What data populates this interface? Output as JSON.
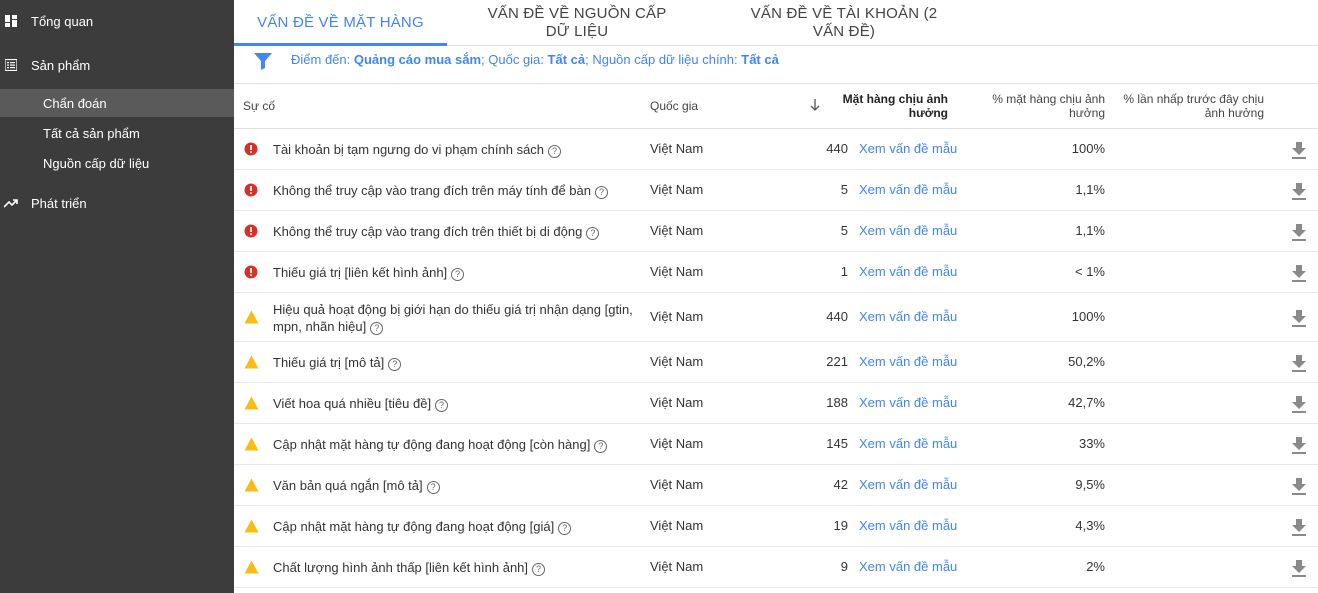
{
  "sidebar": {
    "items": [
      {
        "label": "Tổng quan",
        "icon": "dashboard-icon"
      },
      {
        "label": "Sản phẩm",
        "icon": "list-icon"
      },
      {
        "label": "Phát triển",
        "icon": "trending-icon"
      }
    ],
    "sub_items": [
      {
        "label": "Chẩn đoán",
        "active": true
      },
      {
        "label": "Tất cả sản phẩm",
        "active": false
      },
      {
        "label": "Nguồn cấp dữ liệu",
        "active": false
      }
    ]
  },
  "tabs": [
    {
      "label": "VẤN ĐỀ VỀ MẶT HÀNG",
      "active": true
    },
    {
      "label": "VẤN ĐỀ VỀ NGUỒN CẤP DỮ LIỆU",
      "active": false
    },
    {
      "label": "VẤN ĐỀ VỀ TÀI KHOẢN (2 VẤN ĐỀ)",
      "active": false
    }
  ],
  "filter": {
    "destination_label": "Điểm đến:",
    "destination_value": "Quảng cáo mua sắm",
    "country_label": "; Quốc gia:",
    "country_value": "Tất cả",
    "feed_label": "; Nguồn cấp dữ liệu chính:",
    "feed_value": "Tất cả"
  },
  "table": {
    "headers": {
      "issue": "Sự cố",
      "country": "Quốc gia",
      "affected": "Mặt hàng chịu ảnh hưởng",
      "pct_affected": "% mặt hàng chịu ảnh hưởng",
      "pct_clicks": "% lần nhấp trước đây chịu ảnh hưởng"
    },
    "sort_icon": "arrow-down-icon",
    "rows": [
      {
        "severity": "error",
        "issue": "Tài khoản bị tạm ngưng do vi phạm chính sách",
        "country": "Việt Nam",
        "count": "440",
        "link": "Xem vấn đề mẫu",
        "pct": "100%"
      },
      {
        "severity": "error",
        "issue": "Không thể truy cập vào trang đích trên máy tính để bàn",
        "country": "Việt Nam",
        "count": "5",
        "link": "Xem vấn đề mẫu",
        "pct": "1,1%"
      },
      {
        "severity": "error",
        "issue": "Không thể truy cập vào trang đích trên thiết bị di động",
        "country": "Việt Nam",
        "count": "5",
        "link": "Xem vấn đề mẫu",
        "pct": "1,1%"
      },
      {
        "severity": "error",
        "issue": "Thiếu giá trị [liên kết hình ảnh]",
        "country": "Việt Nam",
        "count": "1",
        "link": "Xem vấn đề mẫu",
        "pct": "< 1%"
      },
      {
        "severity": "warning",
        "issue": "Hiệu quả hoạt động bị giới hạn do thiếu giá trị nhận dạng [gtin, mpn, nhãn hiệu]",
        "country": "Việt Nam",
        "count": "440",
        "link": "Xem vấn đề mẫu",
        "pct": "100%"
      },
      {
        "severity": "warning",
        "issue": "Thiếu giá trị [mô tả]",
        "country": "Việt Nam",
        "count": "221",
        "link": "Xem vấn đề mẫu",
        "pct": "50,2%"
      },
      {
        "severity": "warning",
        "issue": "Viết hoa quá nhiều [tiêu đề]",
        "country": "Việt Nam",
        "count": "188",
        "link": "Xem vấn đề mẫu",
        "pct": "42,7%"
      },
      {
        "severity": "warning",
        "issue": "Cập nhật mặt hàng tự động đang hoạt động [còn hàng]",
        "country": "Việt Nam",
        "count": "145",
        "link": "Xem vấn đề mẫu",
        "pct": "33%"
      },
      {
        "severity": "warning",
        "issue": "Văn bản quá ngắn [mô tả]",
        "country": "Việt Nam",
        "count": "42",
        "link": "Xem vấn đề mẫu",
        "pct": "9,5%"
      },
      {
        "severity": "warning",
        "issue": "Cập nhật mặt hàng tự động đang hoạt động [giá]",
        "country": "Việt Nam",
        "count": "19",
        "link": "Xem vấn đề mẫu",
        "pct": "4,3%"
      },
      {
        "severity": "warning",
        "issue": "Chất lượng hình ảnh thấp [liên kết hình ảnh]",
        "country": "Việt Nam",
        "count": "9",
        "link": "Xem vấn đề mẫu",
        "pct": "2%"
      }
    ]
  },
  "colors": {
    "sidebar_bg": "#3c3c3c",
    "accent": "#4285f4",
    "error": "#d93025",
    "warning": "#f9bc15"
  }
}
